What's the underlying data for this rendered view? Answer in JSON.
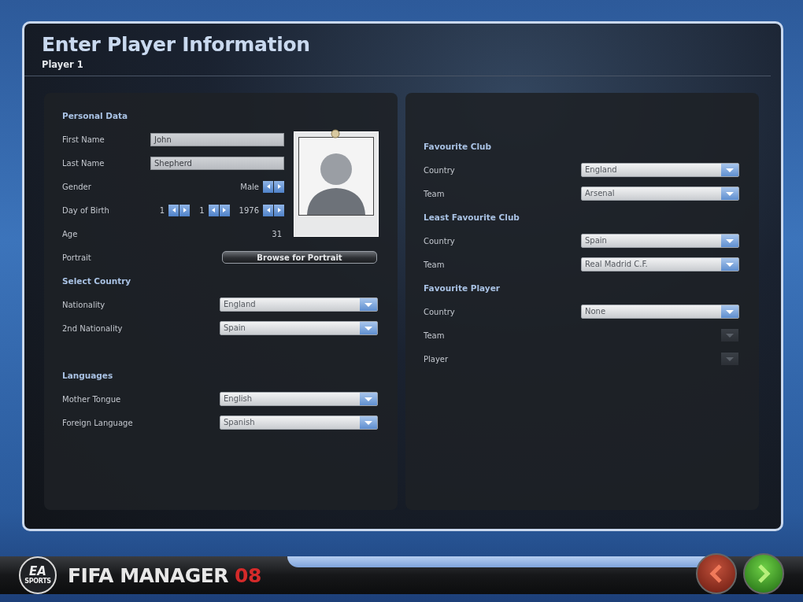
{
  "window": {
    "title": "Enter Player Information",
    "subtitle": "Player 1"
  },
  "left_panel": {
    "sections": [
      {
        "heading": "Personal Data",
        "rows": [
          {
            "kind": "text",
            "label": "First Name",
            "value": "John"
          },
          {
            "kind": "text",
            "label": "Last Name",
            "value": "Shepherd"
          },
          {
            "kind": "stepper",
            "label": "Gender",
            "value": "Male"
          },
          {
            "kind": "date",
            "label": "Day of Birth",
            "parts": [
              "1",
              "1",
              "1976"
            ]
          },
          {
            "kind": "readout",
            "label": "Age",
            "value": "31"
          },
          {
            "kind": "button",
            "label": "Portrait",
            "button": "Browse for Portrait"
          }
        ]
      },
      {
        "heading": "Select Country",
        "rows": [
          {
            "kind": "dropdown",
            "label": "Nationality",
            "value": "England",
            "disabled": false
          },
          {
            "kind": "dropdown",
            "label": "2nd Nationality",
            "value": "Spain",
            "disabled": false
          }
        ]
      },
      {
        "heading": "Languages",
        "rows": [
          {
            "kind": "dropdown",
            "label": "Mother Tongue",
            "value": "English",
            "disabled": false
          },
          {
            "kind": "dropdown",
            "label": "Foreign Language",
            "value": "Spanish",
            "disabled": false
          }
        ]
      }
    ]
  },
  "right_panel": {
    "sections": [
      {
        "heading": "Favourite Club",
        "rows": [
          {
            "kind": "dropdown",
            "label": "Country",
            "value": "England",
            "disabled": false
          },
          {
            "kind": "dropdown",
            "label": "Team",
            "value": "Arsenal",
            "disabled": false
          }
        ]
      },
      {
        "heading": "Least Favourite Club",
        "rows": [
          {
            "kind": "dropdown",
            "label": "Country",
            "value": "Spain",
            "disabled": false
          },
          {
            "kind": "dropdown",
            "label": "Team",
            "value": "Real Madrid C.F.",
            "disabled": false
          }
        ]
      },
      {
        "heading": "Favourite Player",
        "rows": [
          {
            "kind": "dropdown",
            "label": "Country",
            "value": "None",
            "disabled": false
          },
          {
            "kind": "dropdown",
            "label": "Team",
            "disabled": true
          },
          {
            "kind": "dropdown",
            "label": "Player",
            "disabled": true
          }
        ]
      }
    ]
  },
  "footer": {
    "logo": "EA",
    "logo_sub": "SPORTS",
    "title": "FIFA MANAGER",
    "edition": "08"
  }
}
